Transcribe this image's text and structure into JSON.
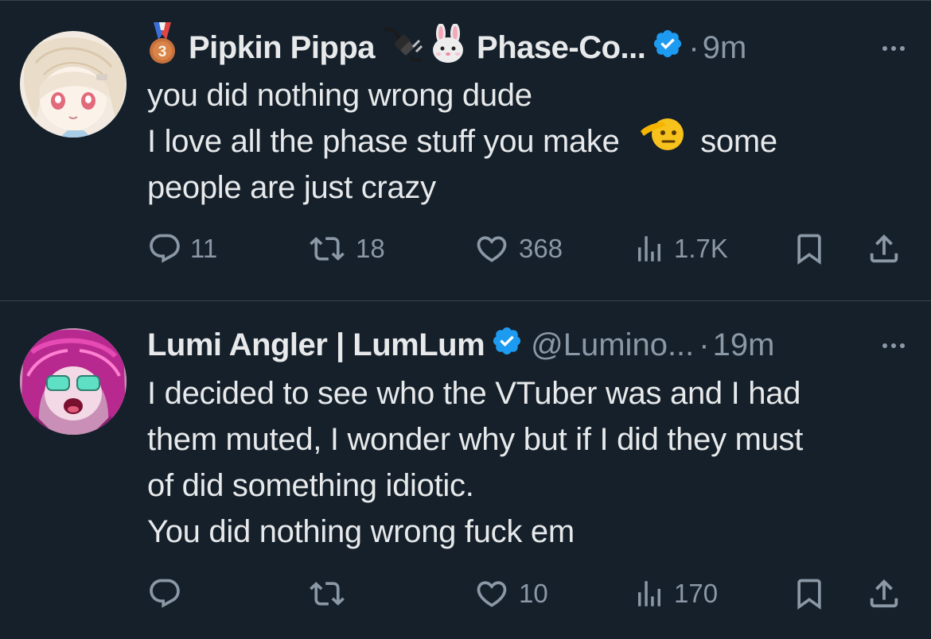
{
  "tweets": [
    {
      "display_name": "Pipkin Pippa",
      "display_name_suffix": "Phase-Co...",
      "name_emojis": [
        "third-place-medal-emoji",
        "electric-plug-emoji",
        "rabbit-face-emoji"
      ],
      "verified": true,
      "time": "9m",
      "lines": [
        "you did nothing wrong dude",
        "I love all the phase stuff you make",
        "some",
        "people are just crazy"
      ],
      "body_emoji": "saluting-face-emoji",
      "replies": "11",
      "retweets": "18",
      "likes": "368",
      "views": "1.7K"
    },
    {
      "display_name": "Lumi Angler | LumLum",
      "handle": "@Lumino...",
      "verified": true,
      "time": "19m",
      "lines": [
        "I decided to see who the VTuber was and I had",
        "them muted, I wonder why but if I did they must",
        "of did something idiotic.",
        "You did nothing wrong fuck em"
      ],
      "replies": "",
      "retweets": "",
      "likes": "10",
      "views": "170"
    }
  ],
  "separator": "·",
  "colors": {
    "background": "#15202b",
    "text": "#e7e9ea",
    "secondary": "#8b98a5",
    "verified": "#1d9bf0",
    "divider": "#38444d"
  },
  "icons": [
    "reply-icon",
    "retweet-icon",
    "like-icon",
    "views-icon",
    "bookmark-icon",
    "share-icon",
    "more-icon"
  ]
}
